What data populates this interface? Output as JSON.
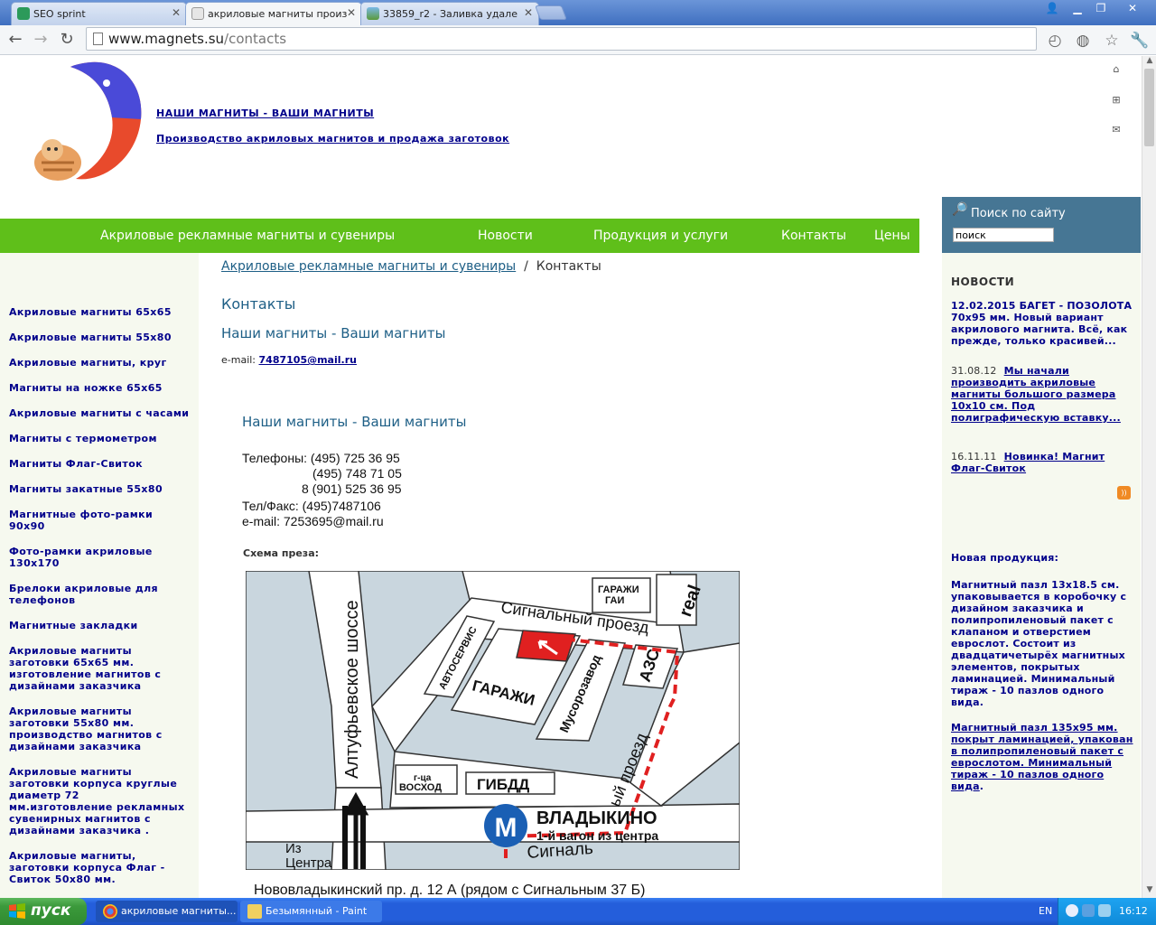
{
  "browser": {
    "tabs": [
      {
        "title": "SEO sprint"
      },
      {
        "title": "акриловые магниты произ"
      },
      {
        "title": "33859_r2 - Заливка удале"
      }
    ],
    "url_host": "www.magnets.su",
    "url_path": "/contacts"
  },
  "header": {
    "tagline": "НАШИ МАГНИТЫ - ВАШИ МАГНИТЫ",
    "subtitle": "Производство акриловых магнитов и продажа заготовок"
  },
  "search": {
    "title": "Поиск по сайту",
    "placeholder": "поиск"
  },
  "nav": {
    "items": [
      "Акриловые рекламные магниты и сувениры",
      "Новости",
      "Продукция и услуги",
      "Контакты",
      "Цены"
    ]
  },
  "sidebar": {
    "items": [
      "Акриловые магниты 65х65",
      "Акриловые магниты 55х80",
      "Акриловые магниты, круг",
      "Магниты на ножке 65х65",
      "Акриловые магниты с часами",
      "Магниты с термометром",
      "Магниты Флаг-Свиток",
      "Магниты закатные 55х80",
      "Магнитные фото-рамки 90х90",
      "Фото-рамки акриловые 130х170",
      "Брелоки акриловые для телефонов",
      "Магнитные закладки",
      "Акриловые магниты заготовки 65х65 мм. изготовление магнитов с дизайнами заказчика",
      "Акриловые магниты заготовки 55х80 мм. производство магнитов с дизайнами заказчика",
      "Акриловые магниты заготовки корпуса круглые диаметр 72 мм.изготовление рекламных сувенирных магнитов с дизайнами заказчика .",
      "Акриловые магниты, заготовки корпуса Флаг - Свиток  50х80 мм."
    ]
  },
  "content": {
    "breadcrumb_link": "Акриловые рекламные магниты и сувениры",
    "breadcrumb_sep": "/",
    "breadcrumb_current": "Контакты",
    "heading": "Контакты",
    "subheading": "Наши магниты - Ваши магниты",
    "email_label": "e-mail:",
    "email": "7487105@mail.ru",
    "subheading2": "Наши магниты - Ваши магниты",
    "phones_label": "Телефоны: (495) 725 36 95",
    "phone2": "(495) 748 71 05",
    "phone3": "8 (901) 525 36 95",
    "fax": "Тел/Факс: (495)7487106",
    "email2": "e-mail: 7253695@mail.ru",
    "scheme_label": "Схема преза:",
    "address": "Нововладыкинский пр. д. 12 А (рядом с Сигнальным 37 Б)"
  },
  "map": {
    "garages_gai": "ГАРАЖИ\nГАИ",
    "real": "real",
    "signal_road_top": "Сигнальный проезд",
    "autoservice": "АВТОСЕРВИС",
    "garages": "ГАРАЖИ",
    "dump": "Мусорозавод",
    "azs": "АЗС",
    "signal_road_right": "Сигнальный проезд",
    "altufievo": "Алтуфьевское шоссе",
    "voshod": "г-ца\nВОСХОД",
    "gibdd": "ГИБДД",
    "signal_bottom": "Сигналь",
    "from_center": "Из\nЦентра",
    "metro_letter": "М",
    "metro_name": "ВЛАДЫКИНО",
    "metro_wagon": "1-й вагон из центра"
  },
  "news": {
    "title": "НОВОСТИ",
    "items": [
      {
        "date": "12.02.2015",
        "text": "БАГЕТ - ПОЗОЛОТА  70х95 мм. Новый вариант акрилового магнита. Всё, как прежде, только красивей..."
      },
      {
        "date": "31.08.12",
        "text": "Мы начали производить акриловые магниты большого размера 10х10 см. Под полиграфическую вставку..."
      },
      {
        "date": "16.11.11",
        "text": "Новинка! Магнит Флаг-Свиток"
      }
    ],
    "new_products_title": "Новая продукция:",
    "product1": " Магнитный пазл  13х18.5 см. упаковывается в коробочку с дизайном заказчика и полипропиленовый пакет с клапаном и отверстием еврослот. Состоит из двадцатичетырёх  магнитных элементов, покрытых ламинацией. Минимальный тираж - 10 пазлов одного вида.",
    "product2": "Магнитный пазл 135х95 мм. покрыт ламинацией, упакован в полипропиленовый  пакет с еврослотом.  Минимальный тираж - 10 пазлов одного вида",
    "product2_suffix": "."
  },
  "taskbar": {
    "start": "пуск",
    "tasks": [
      "акриловые магниты...",
      "Безымянный - Paint"
    ],
    "lang": "EN",
    "time": "16:12"
  },
  "colors": {
    "green_nav": "#5fbf1a",
    "search_box": "#467694",
    "link_navy": "#00008b",
    "heading_blue": "#1e5f86",
    "side_bg": "#f6f9ef"
  }
}
